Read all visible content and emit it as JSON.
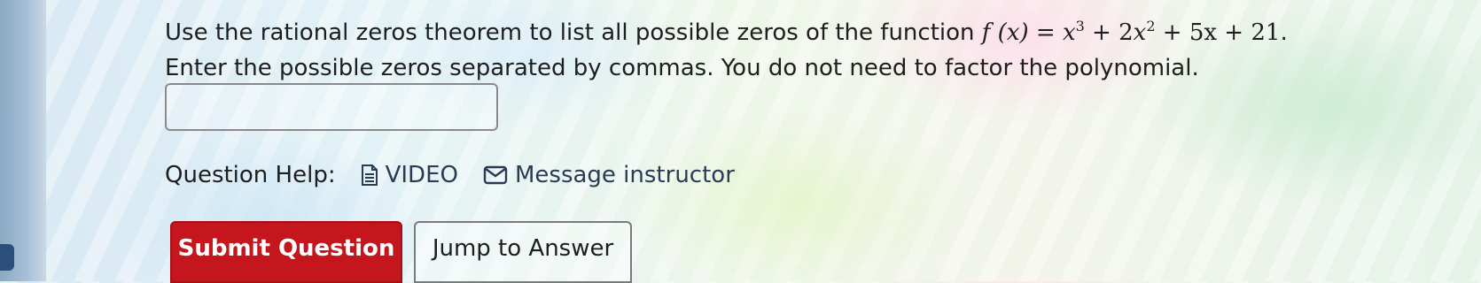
{
  "question": {
    "line1_prefix": "Use the rational zeros theorem to list all possible zeros of the function ",
    "fx": "f (x) = ",
    "term1": "x",
    "exp1": "3",
    "plus1": " + 2",
    "term2": "x",
    "exp2": "2",
    "rest": " + 5x + 21",
    "period": ".",
    "line2": "Enter the possible zeros separated by commas. You do not need to factor the polynomial."
  },
  "answer": {
    "value": "",
    "placeholder": ""
  },
  "help": {
    "label": "Question Help:",
    "video_label": "VIDEO",
    "message_label": "Message instructor"
  },
  "buttons": {
    "submit_label": "Submit Question",
    "jump_label": "Jump to Answer"
  },
  "colors": {
    "submit_bg": "#c4161c",
    "text": "#1e1e1e"
  }
}
